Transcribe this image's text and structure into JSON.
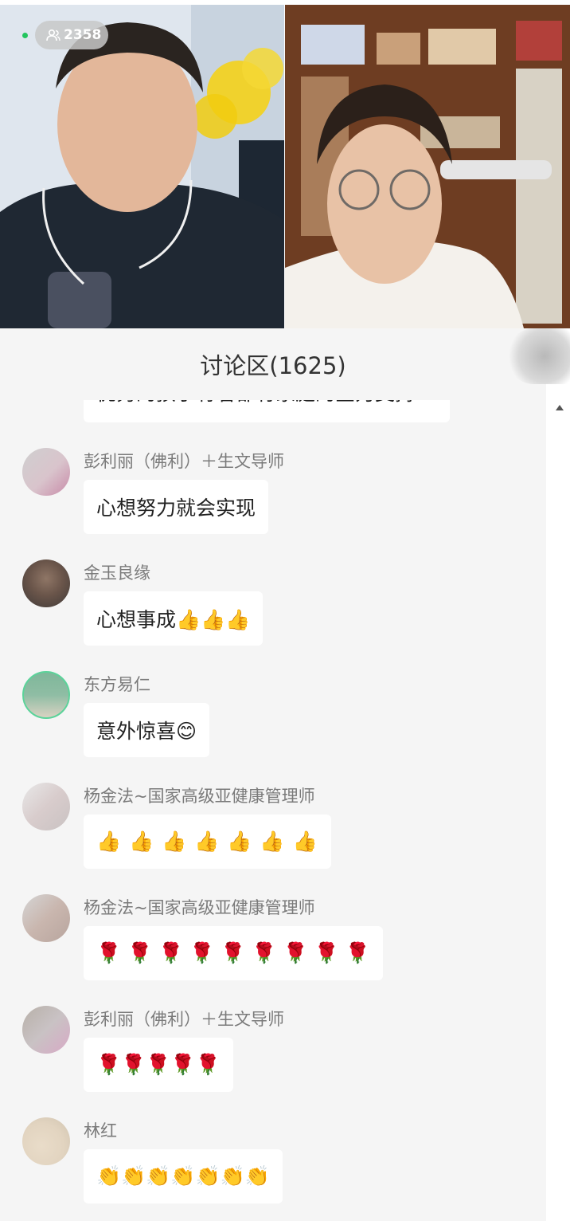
{
  "live": {
    "viewer_count": "2358",
    "viewer_icon": "people-icon"
  },
  "discussion": {
    "title": "讨论区(1625)",
    "partial_message": "优秀的孩子有着都有家庭的全力支持",
    "messages": [
      {
        "user": "彭利丽（佛利）＋生文导师",
        "text": "心想努力就会实现"
      },
      {
        "user": "金玉良缘",
        "text": "心想事成👍👍👍"
      },
      {
        "user": "东方易仁",
        "text": "意外惊喜😊"
      },
      {
        "user": "杨金法~国家高级亚健康管理师",
        "text": "👍 👍 👍 👍 👍 👍 👍"
      },
      {
        "user": "杨金法~国家高级亚健康管理师",
        "text": "🌹 🌹 🌹 🌹 🌹 🌹 🌹 🌹 🌹"
      },
      {
        "user": "彭利丽（佛利）＋生文导师",
        "text": "🌹🌹🌹🌹🌹"
      },
      {
        "user": "林红",
        "text": "👏👏👏👏👏👏👏"
      }
    ]
  },
  "colors": {
    "live_dot": "#22c55e",
    "bubble_bg": "#ffffff",
    "page_bg": "#f5f5f5"
  }
}
